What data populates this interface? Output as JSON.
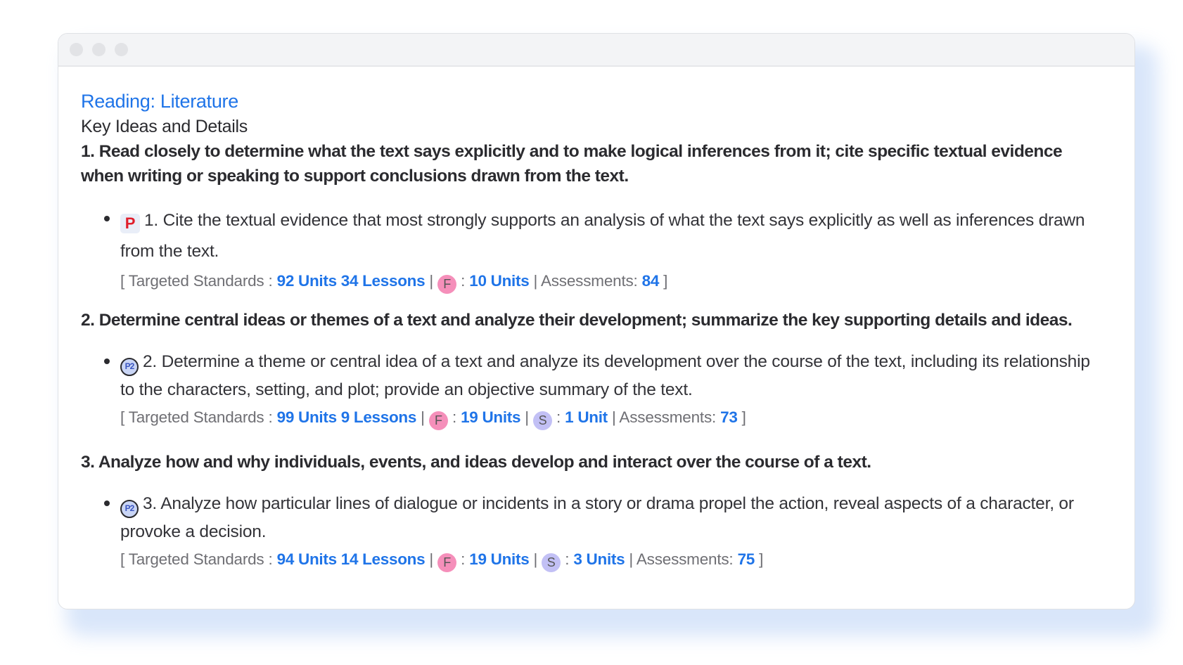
{
  "window": {
    "controls": [
      "close",
      "minimize",
      "maximize"
    ]
  },
  "page": {
    "category": "Reading: Literature",
    "cluster": "Key Ideas and Details"
  },
  "labels": {
    "targeted_prefix": "[ Targeted Standards :",
    "separator": "|",
    "colon": ":",
    "assessments": "Assessments:",
    "close_bracket": "]",
    "badge_f": "F",
    "badge_s": "S"
  },
  "icons": {
    "p_icon": "P",
    "p2_icon": "P2"
  },
  "standards": [
    {
      "text": "1. Read closely to determine what the text says explicitly and to make logical inferences from it; cite specific textual evidence when writing or speaking to support conclusions drawn from the text.",
      "sub": {
        "icon": "p-icon",
        "text": "1. Cite the textual evidence that most strongly supports an analysis of what the text says explicitly as well as inferences drawn from the text.",
        "targeted": "92 Units 34 Lessons",
        "f_units": "10 Units",
        "s_units": null,
        "assessments": "84"
      }
    },
    {
      "text": "2. Determine central ideas or themes of a text and analyze their development; summarize the key supporting details and ideas.",
      "sub": {
        "icon": "p2-icon",
        "text": "2. Determine a theme or central idea of a text and analyze its development over the course of the text, including its relationship to the characters, setting, and plot; provide an objective summary of the text.",
        "targeted": "99 Units 9 Lessons",
        "f_units": "19 Units",
        "s_units": "1 Unit",
        "assessments": "73"
      }
    },
    {
      "text": "3. Analyze how and why individuals, events, and ideas develop and interact over the course of a text.",
      "sub": {
        "icon": "p2-icon",
        "text": "3. Analyze how particular lines of dialogue or incidents in a story or drama propel the action, reveal aspects of a character, or provoke a decision.",
        "targeted": "94 Units 14 Lessons",
        "f_units": "19 Units",
        "s_units": "3 Units",
        "assessments": "75"
      }
    }
  ],
  "colors": {
    "link": "#1f74e8",
    "badge_f": "#f58fba",
    "badge_s": "#c2c0f5",
    "p_icon": "#e01e2b"
  }
}
